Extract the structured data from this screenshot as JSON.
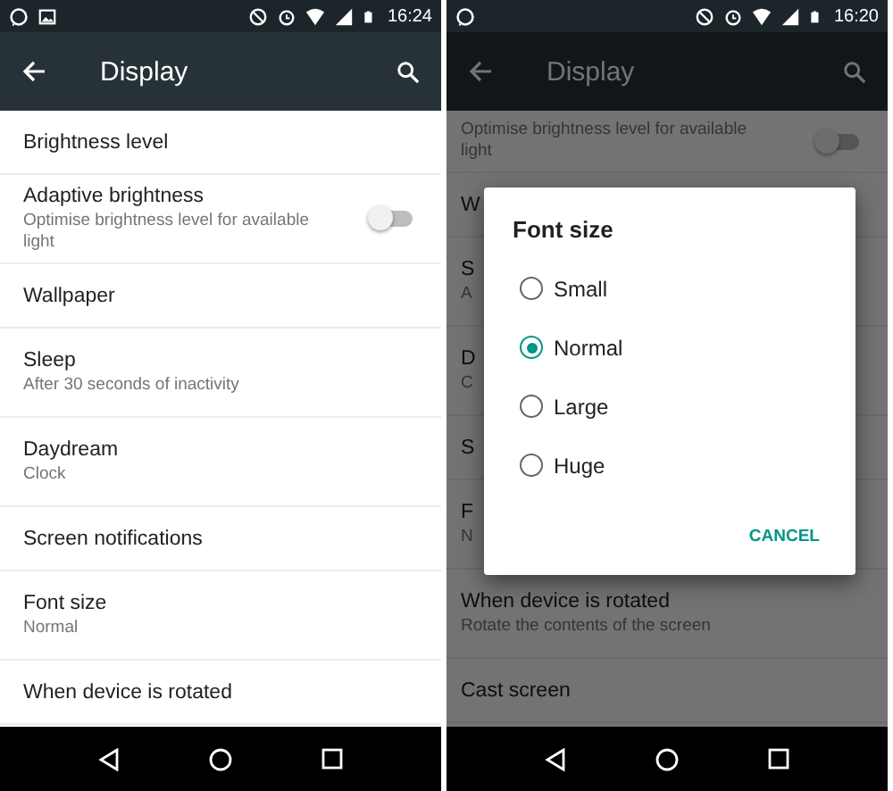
{
  "phones": [
    {
      "status_bar": {
        "notifications": [
          {
            "kind": "chat"
          },
          {
            "kind": "image"
          }
        ],
        "time": "16:24"
      },
      "toolbar": {
        "title": "Display"
      },
      "rows": [
        {
          "kind": "plain",
          "title": "Brightness level"
        },
        {
          "kind": "toggle",
          "title": "Adaptive brightness",
          "subtitle": "Optimise brightness level for available light",
          "on": false
        },
        {
          "kind": "plain",
          "title": "Wallpaper"
        },
        {
          "kind": "plain",
          "title": "Sleep",
          "subtitle": "After 30 seconds of inactivity"
        },
        {
          "kind": "plain",
          "title": "Daydream",
          "subtitle": "Clock"
        },
        {
          "kind": "plain",
          "title": "Screen notifications"
        },
        {
          "kind": "plain",
          "title": "Font size",
          "subtitle": "Normal"
        },
        {
          "kind": "plain",
          "title": "When device is rotated"
        }
      ]
    },
    {
      "status_bar": {
        "notifications": [
          {
            "kind": "chat"
          }
        ],
        "time": "16:20"
      },
      "toolbar": {
        "title": "Display"
      },
      "rows": [
        {
          "kind": "toggle",
          "subtitle": "Optimise brightness level for available light",
          "on": false
        },
        {
          "kind": "plain",
          "title": "W"
        },
        {
          "kind": "plain",
          "title": "S",
          "subtitle": "A"
        },
        {
          "kind": "plain",
          "title": "D",
          "subtitle": "C"
        },
        {
          "kind": "plain",
          "title": "S"
        },
        {
          "kind": "plain",
          "title": "F",
          "subtitle": "N"
        },
        {
          "kind": "plain",
          "title": "When device is rotated",
          "subtitle": "Rotate the contents of the screen"
        },
        {
          "kind": "plain",
          "title": "Cast screen"
        }
      ],
      "dialog": {
        "title": "Font size",
        "options": [
          {
            "label": "Small",
            "selected": false
          },
          {
            "label": "Normal",
            "selected": true
          },
          {
            "label": "Large",
            "selected": false
          },
          {
            "label": "Huge",
            "selected": false
          }
        ],
        "button": "CANCEL"
      }
    }
  ]
}
